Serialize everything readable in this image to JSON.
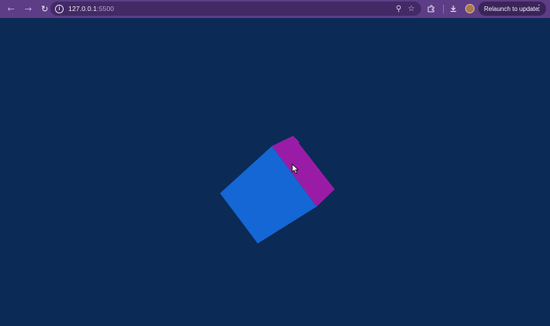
{
  "browser": {
    "back_icon": "arrow-left-icon",
    "forward_icon": "arrow-right-icon",
    "reload_icon": "reload-icon",
    "omnibox": {
      "site_info_icon": "info-icon",
      "url_host": "127.0.0.1",
      "url_port": ":5500",
      "zoom_icon": "zoom-icon",
      "bookmark_icon": "star-icon"
    },
    "extensions_icon": "puzzle-icon",
    "download_icon": "download-icon",
    "relaunch_label": "Relaunch to update",
    "menu_icon": "more-vertical-icon"
  },
  "scene": {
    "background_color": "#0b2a55",
    "cube": {
      "front_face_color": "#1467d4",
      "side_face_color": "#9a1ca6",
      "top_face_color": "#b01fb5"
    }
  },
  "colors": {
    "toolbar": "#5c3d86",
    "omnibox": "#432a66",
    "relaunch_button": "#3b2459"
  }
}
